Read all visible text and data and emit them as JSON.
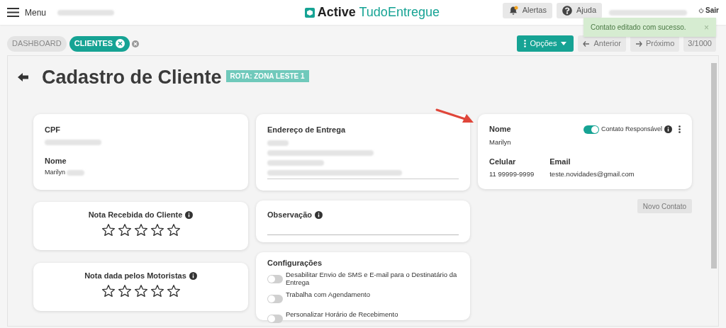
{
  "header": {
    "menu_label": "Menu",
    "logo": {
      "bold": "Active",
      "rest": "TudoEntregue"
    },
    "buttons": [
      {
        "kind": "alerts",
        "label": "Alertas",
        "badge": true
      },
      {
        "kind": "help",
        "label": "Ajuda",
        "badge": false
      }
    ],
    "logout": "Sair"
  },
  "toast": {
    "message": "Contato editado com sucesso.",
    "close": "×"
  },
  "tabs": [
    {
      "label": "DASHBOARD",
      "selected": false,
      "closable": false
    },
    {
      "label": "CLIENTES",
      "selected": true,
      "closable": true
    }
  ],
  "toolbar": {
    "options": "Opções",
    "previous": "Anterior",
    "next": "Próximo",
    "counter": "3/1000"
  },
  "page": {
    "title": "Cadastro de Cliente",
    "route_badge": "ROTA: ZONA LESTE 1"
  },
  "client_card": {
    "fields": [
      {
        "label": "CPF"
      },
      {
        "label": "Nome",
        "value": "Marilyn"
      }
    ]
  },
  "address_card": {
    "label": "Endereço de Entrega"
  },
  "ratings": [
    {
      "title": "Nota Recebida do Cliente",
      "stars": 0
    },
    {
      "title": "Nota dada pelos Motoristas",
      "stars": 0
    }
  ],
  "observation": {
    "label": "Observação"
  },
  "settings": {
    "title": "Configurações",
    "options": [
      {
        "label": "Desabilitar Envio de SMS e E-mail para o Destinatário da Entrega",
        "on": false
      },
      {
        "label": "Trabalha com Agendamento",
        "on": false
      },
      {
        "label": "Personalizar Horário de Recebimento",
        "on": false
      }
    ]
  },
  "contact": {
    "name_label": "Nome",
    "name": "Marilyn",
    "responsible_label": "Contato Responsável",
    "responsible": true,
    "phone_label": "Celular",
    "phone": "11 99999-9999",
    "email_label": "Email",
    "email": "teste.novidades@gmail.com"
  },
  "new_contact": "Novo Contato"
}
